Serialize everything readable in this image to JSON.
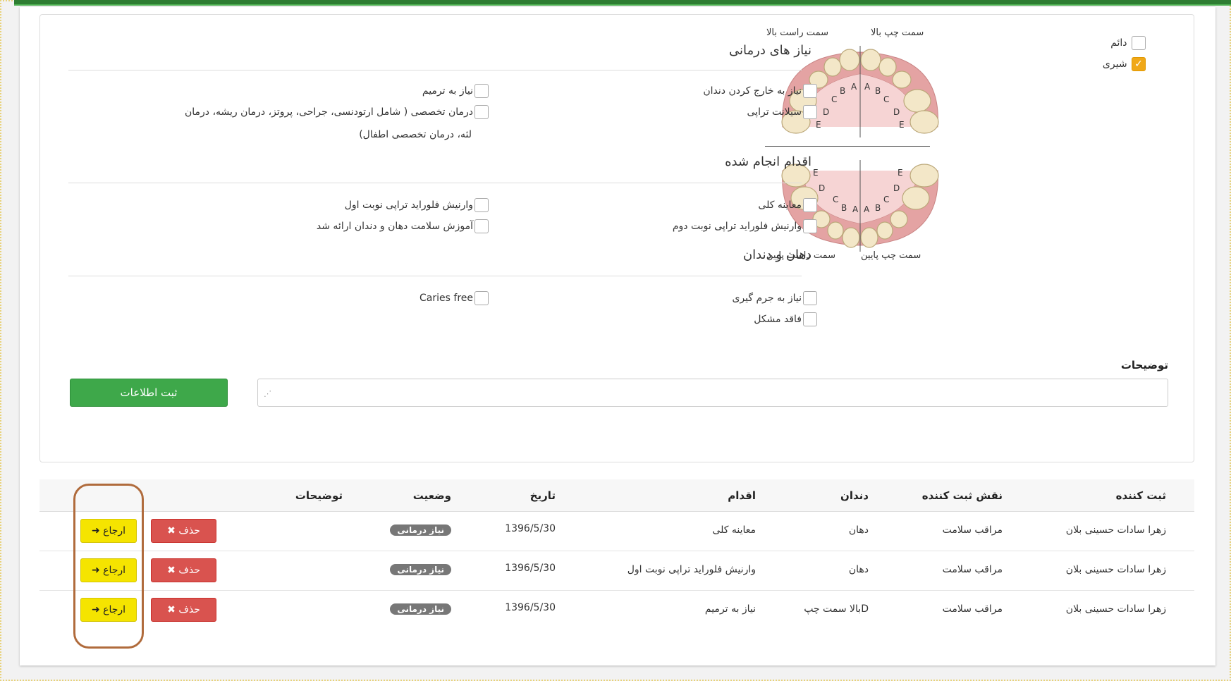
{
  "tooth_type": {
    "permanent_label": "دائم",
    "permanent_checked": false,
    "primary_label": "شیری",
    "primary_checked": true
  },
  "jaw": {
    "upper_left_label": "سمت چپ بالا",
    "upper_right_label": "سمت راست بالا",
    "lower_left_label": "سمت چپ پایین",
    "lower_right_label": "سمت راست پایین"
  },
  "sections": {
    "treatment_needs": {
      "title": "نیاز های درمانی",
      "items": [
        {
          "label": "نیاز به خارج کردن دندان",
          "checked": false
        },
        {
          "label": "سیلانت تراپی",
          "checked": false
        },
        {
          "label": "نیاز به ترمیم",
          "checked": false
        },
        {
          "label": "درمان تخصصی ( شامل ارتودنسی، جراحی، پروتز، درمان ریشه، درمان",
          "label_line2": "لثه، درمان تخصصی اطفال)",
          "checked": false
        }
      ]
    },
    "actions_done": {
      "title": "اقدام انجام شده",
      "items": [
        {
          "label": "معاینه کلی",
          "checked": false
        },
        {
          "label": "وارنیش فلوراید تراپی نوبت دوم",
          "checked": false
        },
        {
          "label": "وارنیش فلوراید تراپی نوبت اول",
          "checked": false
        },
        {
          "label": "آموزش سلامت دهان و دندان ارائه شد",
          "checked": false
        }
      ]
    },
    "mouth": {
      "title": "دهان و دندان",
      "items": [
        {
          "label": "نیاز به جرم گیری",
          "checked": false
        },
        {
          "label": "فاقد مشکل",
          "checked": false
        },
        {
          "label": "Caries free",
          "checked": false
        }
      ]
    }
  },
  "notes": {
    "label": "توضیحات",
    "value": ""
  },
  "submit_label": "ثبت اطلاعات",
  "table": {
    "headers": {
      "registrar": "ثبت کننده",
      "role": "نقش ثبت کننده",
      "tooth": "دندان",
      "action": "اقدام",
      "date": "تاریخ",
      "status": "وضعیت",
      "notes": "توضیحات"
    },
    "delete_label": "حذف",
    "refer_label": "ارجاع",
    "rows": [
      {
        "registrar": "زهرا سادات حسینی بلان",
        "role": "مراقب سلامت",
        "tooth": "دهان",
        "action": "معاینه کلی",
        "date": "1396/5/30",
        "status": "نیاز درمانی",
        "notes": ""
      },
      {
        "registrar": "زهرا سادات حسینی بلان",
        "role": "مراقب سلامت",
        "tooth": "دهان",
        "action": "وارنیش فلوراید تراپی نوبت اول",
        "date": "1396/5/30",
        "status": "نیاز درمانی",
        "notes": ""
      },
      {
        "registrar": "زهرا سادات حسینی بلان",
        "role": "مراقب سلامت",
        "tooth": "Dبالا سمت چپ",
        "action": "نیاز به ترمیم",
        "date": "1396/5/30",
        "status": "نیاز درمانی",
        "notes": ""
      }
    ]
  },
  "colors": {
    "submit": "#3ea84a",
    "delete": "#d9534f",
    "refer": "#f5e400",
    "badge": "#777777",
    "checked": "#f0a818",
    "highlight": "#b06b3c"
  }
}
